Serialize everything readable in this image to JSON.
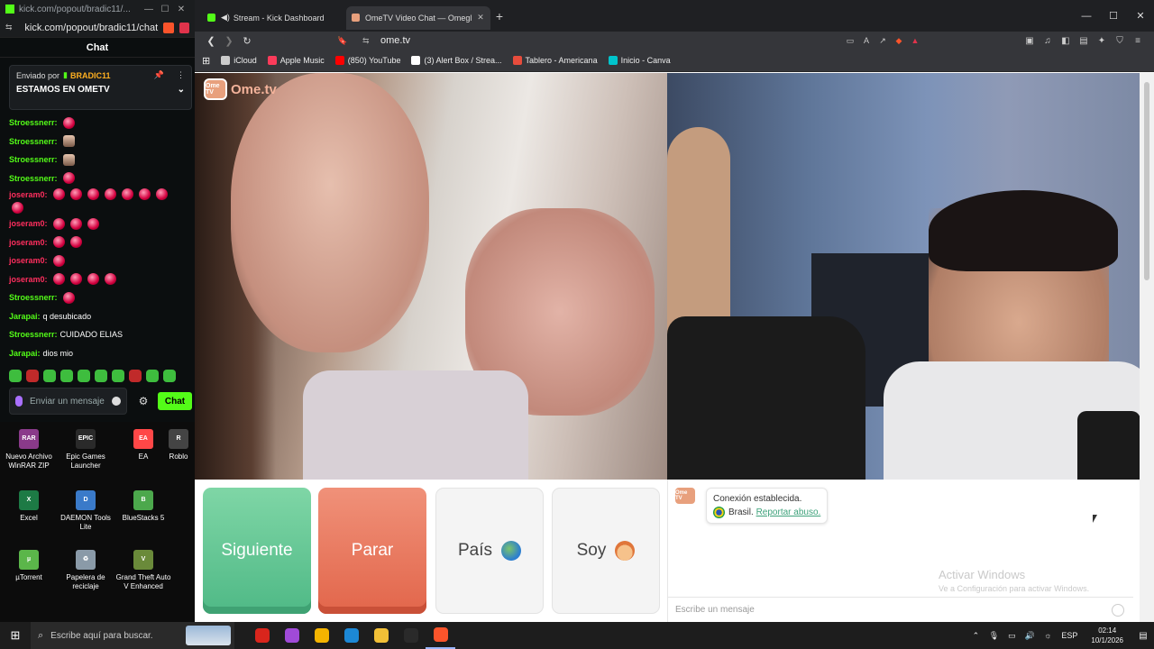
{
  "chat_window": {
    "title_url": "kick.com/popout/bradic11/...",
    "address": "kick.com/popout/bradic11/chat",
    "header": "Chat",
    "pinned": {
      "sent_by_label": "Enviado por",
      "user": "BRADIC11",
      "message": "ESTAMOS EN OMETV"
    },
    "messages": [
      {
        "user": "Stroessnerr:",
        "color": "#53fc18",
        "text": "",
        "emotes": 1,
        "face": false
      },
      {
        "user": "Stroessnerr:",
        "color": "#53fc18",
        "text": "",
        "emotes": 1,
        "face": true
      },
      {
        "user": "Stroessnerr:",
        "color": "#53fc18",
        "text": "",
        "emotes": 1,
        "face": true
      },
      {
        "user": "Stroessnerr:",
        "color": "#53fc18",
        "text": "",
        "emotes": 1,
        "face": false
      },
      {
        "user": "joseram0:",
        "color": "#ff2e5e",
        "text": "",
        "emotes": 8,
        "face": false
      },
      {
        "user": "joseram0:",
        "color": "#ff2e5e",
        "text": "",
        "emotes": 3,
        "face": false
      },
      {
        "user": "joseram0:",
        "color": "#ff2e5e",
        "text": "",
        "emotes": 2,
        "face": false
      },
      {
        "user": "joseram0:",
        "color": "#ff2e5e",
        "text": "",
        "emotes": 1,
        "face": false
      },
      {
        "user": "joseram0:",
        "color": "#ff2e5e",
        "text": "",
        "emotes": 4,
        "face": false
      },
      {
        "user": "Stroessnerr:",
        "color": "#53fc18",
        "text": "",
        "emotes": 1,
        "face": false
      },
      {
        "user": "Jarapai:",
        "color": "#53fc18",
        "text": "q desubicado",
        "emotes": 0,
        "face": false
      },
      {
        "user": "Stroessnerr:",
        "color": "#53fc18",
        "text": "CUIDADO ELIAS",
        "emotes": 0,
        "face": false
      },
      {
        "user": "Jarapai:",
        "color": "#53fc18",
        "text": "dios mio",
        "emotes": 0,
        "face": false
      }
    ],
    "input_placeholder": "Enviar un mensaje",
    "send_label": "Chat"
  },
  "desktop_icons": [
    {
      "label": "Nuevo Archivo WinRAR ZIP",
      "color": "#8a3a8a",
      "glyph": "RAR"
    },
    {
      "label": "Epic Games Launcher",
      "color": "#2a2a2a",
      "glyph": "EPIC"
    },
    {
      "label": "EA",
      "color": "#ff4747",
      "glyph": "EA"
    },
    {
      "label": "Roblo",
      "color": "#444444",
      "glyph": "R"
    },
    {
      "label": "Excel",
      "color": "#1d7a45",
      "glyph": "X"
    },
    {
      "label": "DAEMON Tools Lite",
      "color": "#3a7ac9",
      "glyph": "D"
    },
    {
      "label": "BlueStacks 5",
      "color": "#4ca84c",
      "glyph": "B"
    },
    {
      "label": "µTorrent",
      "color": "#5bb64a",
      "glyph": "µ"
    },
    {
      "label": "Papelera de reciclaje",
      "color": "#8a9aa8",
      "glyph": "♻"
    },
    {
      "label": "Grand Theft Auto V Enhanced",
      "color": "#6a8a3a",
      "glyph": "V"
    }
  ],
  "browser": {
    "tabs": [
      {
        "title": "Stream - Kick Dashboard",
        "active": false,
        "fav": "#53fc18"
      },
      {
        "title": "OmeTV Video Chat — Omegl",
        "active": true,
        "fav": "#e8a07d"
      }
    ],
    "url": "ome.tv",
    "bookmarks": [
      {
        "label": "iCloud",
        "color": "#cccccc"
      },
      {
        "label": "Apple Music",
        "color": "#fa3b5a"
      },
      {
        "label": "(850) YouTube",
        "color": "#ff0000"
      },
      {
        "label": "(3) Alert Box / Strea...",
        "color": "#ffffff"
      },
      {
        "label": "Tablero - Americana",
        "color": "#e74c3c"
      },
      {
        "label": "Inicio - Canva",
        "color": "#00c4cc"
      }
    ]
  },
  "ometv": {
    "logo_text": "Ome.tv",
    "logo_badge": "Ome TV",
    "buttons": {
      "next": "Siguiente",
      "stop": "Parar",
      "country": "País",
      "gender": "Soy"
    },
    "system_message": {
      "status": "Conexión establecida.",
      "country": "Brasil.",
      "report": "Reportar abuso."
    },
    "input_placeholder": "Escribe un mensaje"
  },
  "windows_watermark": {
    "title": "Activar Windows",
    "subtitle": "Ve a Configuración para activar Windows."
  },
  "taskbar": {
    "search_placeholder": "Escribe aquí para buscar.",
    "apps": [
      "#d9251c",
      "#a04ad8",
      "#f4b400",
      "#1c88d6",
      "#f2c037",
      "#2a2a2a",
      "#fb542b"
    ],
    "language": "ESP",
    "time": "02:14",
    "date": "10/1/2026"
  }
}
